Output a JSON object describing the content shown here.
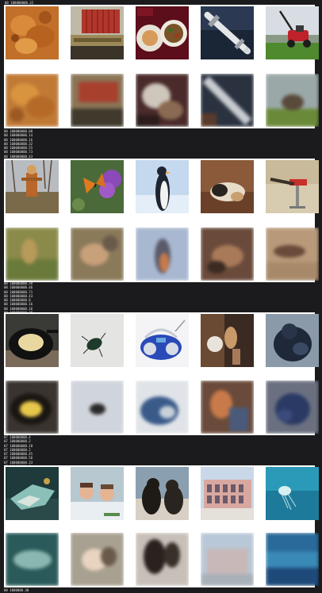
{
  "header": {
    "text": "00  100000000.32"
  },
  "logs": [
    [
      "00  100000000.00",
      "00  100000000.14",
      "00  100000000.16",
      "00  100000000.32",
      "00  100000000.55",
      "00  100000000.73",
      "00  100000000.43",
      "00  100000000.64",
      "00  100000000.73"
    ],
    [
      "00  100000000.39",
      "00  100000000.46",
      "00  100000000.71",
      "00  100000000.43",
      "00  100000000.8",
      "00  100000000.16",
      "00  100000000.16",
      "00  100000000.29",
      "00  100000000.53"
    ],
    [
      "07  100000000.4",
      "07  100000000.2",
      "07  100000000.18",
      "07  100000000.2",
      "07  100000000.45",
      "07  100000000.56",
      "07  100000000.33",
      "07  100000000.8"
    ]
  ],
  "footer": {
    "text": "00  1000000.30"
  },
  "panels": [
    {
      "originals": [
        "fried-food",
        "shipping-container",
        "food-plates",
        "missile",
        "lawn-mower"
      ],
      "reconstructions": [
        "fried-food-recon",
        "container-recon",
        "plates-recon",
        "missile-recon",
        "mower-recon"
      ]
    },
    {
      "originals": [
        "scarecrow",
        "butterfly-flowers",
        "penguin",
        "dog-sleeping",
        "gym-equipment"
      ],
      "reconstructions": [
        "scarecrow-recon",
        "butterfly-recon",
        "penguin-recon",
        "dog-recon",
        "gym-recon"
      ]
    },
    {
      "originals": [
        "frying-pan-rice",
        "beetle",
        "boombox",
        "rider",
        "gorilla"
      ],
      "reconstructions": [
        "pan-recon",
        "beetle-recon",
        "boombox-recon",
        "rider-recon",
        "gorilla-recon"
      ]
    },
    {
      "originals": [
        "coral-fish",
        "kids-bathtub",
        "two-dogs",
        "building",
        "jellyfish"
      ],
      "reconstructions": [
        "coral-recon",
        "kids-recon",
        "dogs-recon",
        "building-recon",
        "jellyfish-recon"
      ]
    }
  ],
  "colors": {
    "background": "#1b1b1d",
    "panel": "#ffffff",
    "log_text": "#e0e0e0"
  }
}
